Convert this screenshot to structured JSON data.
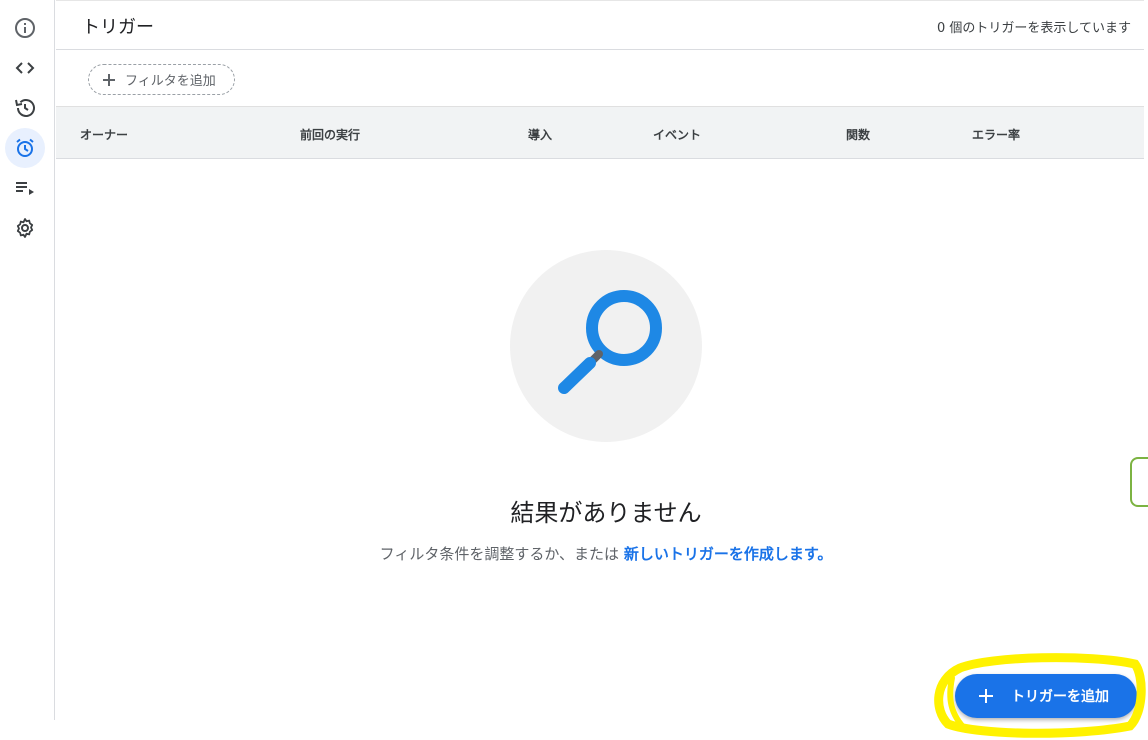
{
  "header": {
    "title": "トリガー",
    "count_text": "0 個のトリガーを表示しています"
  },
  "sidebar": {
    "items": [
      {
        "icon": "info-icon",
        "active": false
      },
      {
        "icon": "code-icon",
        "active": false
      },
      {
        "icon": "history-icon",
        "active": false
      },
      {
        "icon": "alarm-icon",
        "active": true
      },
      {
        "icon": "playlist-play-icon",
        "active": false
      },
      {
        "icon": "gear-icon",
        "active": false
      }
    ]
  },
  "filter": {
    "add_label": "フィルタを追加"
  },
  "table": {
    "columns": [
      "オーナー",
      "前回の実行",
      "導入",
      "イベント",
      "関数",
      "エラー率"
    ]
  },
  "empty": {
    "title": "結果がありません",
    "subtitle_prefix": "フィルタ条件を調整するか、または ",
    "subtitle_link": "新しいトリガーを作成します。"
  },
  "fab": {
    "label": "トリガーを追加"
  },
  "colors": {
    "accent": "#1a73e8",
    "highlight": "#fff200",
    "magnifier": "#1e88e5"
  }
}
